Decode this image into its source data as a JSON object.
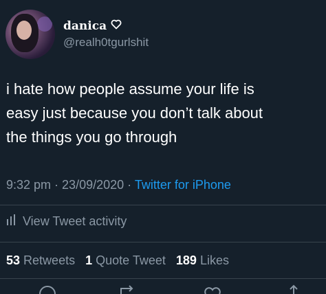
{
  "author": {
    "display_name": "danica",
    "handle": "@realh0tgurlshit",
    "avatar_icon": "profile-photo",
    "badge_icon": "heart-outline-icon"
  },
  "tweet": {
    "text": "i hate how people assume your life is\neasy just because you don’t talk about\nthe things you go through"
  },
  "meta": {
    "time": "9:32 pm",
    "separator": " · ",
    "date": "23/09/2020",
    "source": "Twitter for iPhone"
  },
  "activity": {
    "label": "View Tweet activity",
    "icon": "bar-chart-icon"
  },
  "stats": {
    "retweets_count": "53",
    "retweets_label": "Retweets",
    "quotes_count": "1",
    "quotes_label": "Quote Tweet",
    "likes_count": "189",
    "likes_label": "Likes"
  },
  "colors": {
    "background": "#15202b",
    "text": "#ffffff",
    "secondary": "#8b98a5",
    "accent": "#1d9bf0",
    "divider": "#38444d"
  }
}
